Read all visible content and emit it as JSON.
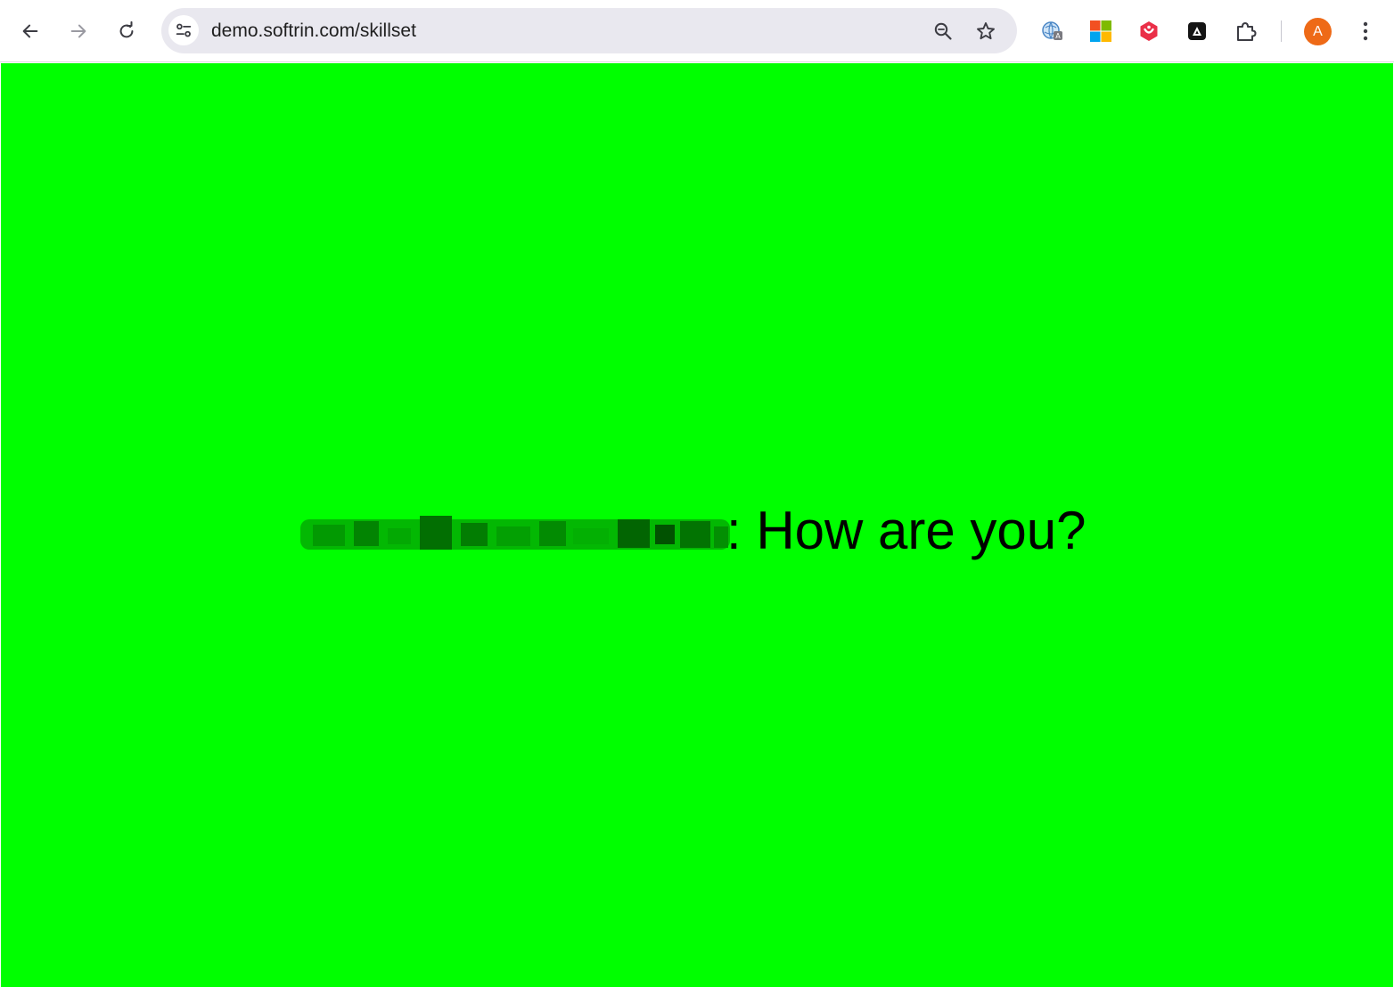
{
  "browser": {
    "url": "demo.softrin.com/skillset",
    "profile_initial": "A",
    "profile_color": "#ee6a17",
    "toolbar_icons": [
      "back-arrow-icon",
      "forward-arrow-icon",
      "reload-icon",
      "site-info-icon",
      "zoom-icon",
      "bookmark-star-icon",
      "extensions-puzzle-icon",
      "more-menu-icon"
    ],
    "extensions": [
      "translate-extension-icon",
      "microsoft-extension-icon",
      "red-shield-extension-icon",
      "dark-a-extension-icon"
    ]
  },
  "page": {
    "background_color": "#00ff00",
    "message_suffix": ": How are you?"
  }
}
